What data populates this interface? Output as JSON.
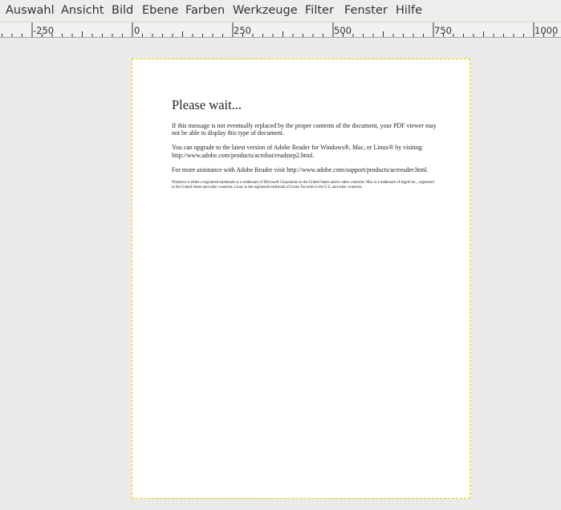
{
  "menubar": {
    "items": [
      "Auswahl",
      "Ansicht",
      "Bild",
      "Ebene",
      "Farben",
      "Werkzeuge",
      "Filter",
      "Fenster",
      "Hilfe"
    ]
  },
  "ruler": {
    "labels": [
      "-250",
      "0",
      "250",
      "500",
      "750",
      "1000"
    ]
  },
  "document": {
    "title": "Please wait...",
    "p1": "If this message is not eventually replaced by the proper contents of the document, your PDF viewer may not be able to display this type of document.",
    "p2": "You can upgrade to the latest version of Adobe Reader for Windows®, Mac, or Linux® by visiting  http://www.adobe.com/products/acrobat/readstep2.html.",
    "p3": "For more assistance with Adobe Reader visit  http://www.adobe.com/support/products/acrreader.html.",
    "fine_print": "Windows is either a registered trademark or a trademark of Microsoft Corporation in the United States and/or other countries. Mac is a trademark of Apple Inc., registered in the United States and other countries. Linux is the registered trademark of Linus Torvalds in the U.S. and other countries."
  },
  "colors": {
    "selection_border": "#f0d000",
    "canvas_background": "#ebeae8"
  }
}
